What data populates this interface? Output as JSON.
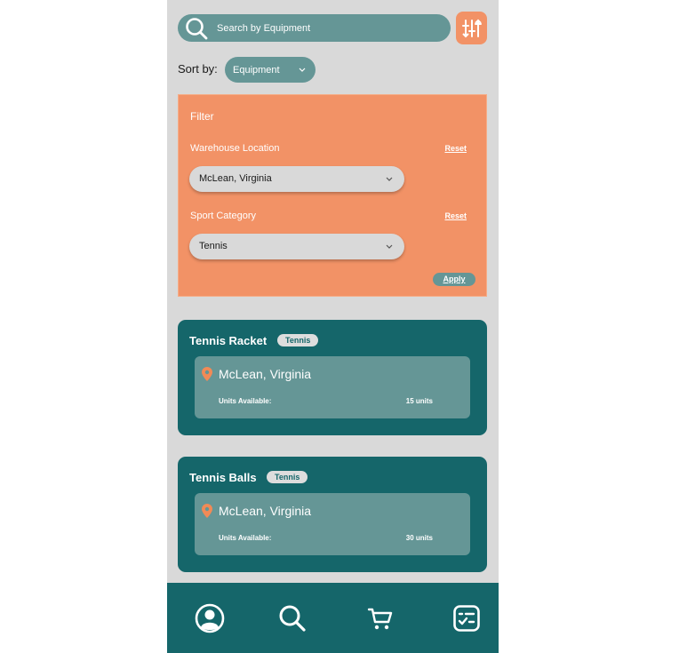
{
  "search": {
    "placeholder": "Search by Equipment",
    "icon": "search-icon"
  },
  "filter_toggle": {
    "icon": "sliders-icon"
  },
  "sort": {
    "label": "Sort by:",
    "value": "Equipment"
  },
  "filter": {
    "title": "Filter",
    "warehouse": {
      "label": "Warehouse Location",
      "reset": "Reset",
      "value": "McLean, Virginia"
    },
    "sport": {
      "label": "Sport Category",
      "reset": "Reset",
      "value": "Tennis"
    },
    "apply": "Apply"
  },
  "items": [
    {
      "name": "Tennis Racket",
      "tag": "Tennis",
      "location": "McLean, Virginia",
      "units_label": "Units Available:",
      "units": "15 units"
    },
    {
      "name": "Tennis Balls",
      "tag": "Tennis",
      "location": "McLean, Virginia",
      "units_label": "Units Available:",
      "units": "30 units"
    }
  ],
  "nav": [
    {
      "name": "profile",
      "icon": "user-icon"
    },
    {
      "name": "search",
      "icon": "search-icon"
    },
    {
      "name": "cart",
      "icon": "cart-icon"
    },
    {
      "name": "checklist",
      "icon": "checklist-icon"
    }
  ],
  "colors": {
    "teal": "#659696",
    "dark_teal": "#15666a",
    "orange": "#f29266",
    "gray": "#d9d9d9"
  }
}
